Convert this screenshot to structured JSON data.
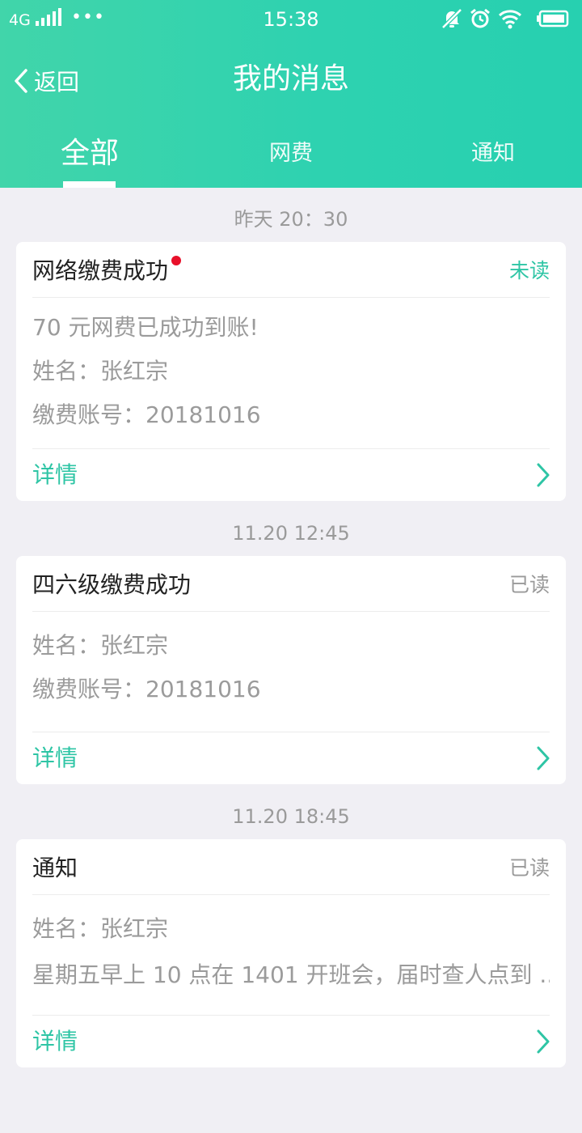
{
  "status_bar": {
    "network": "4G",
    "dots": "•••",
    "time": "15:38"
  },
  "nav": {
    "back_label": "返回",
    "title": "我的消息"
  },
  "tabs": [
    {
      "label": "全部",
      "active": true
    },
    {
      "label": "网费",
      "active": false
    },
    {
      "label": "通知",
      "active": false
    }
  ],
  "messages": [
    {
      "time": "昨天 20：30",
      "title": "网络缴费成功",
      "unread_dot": true,
      "status": "未读",
      "lines": [
        "70 元网费已成功到账!",
        "姓名：张红宗",
        "缴费账号：20181016"
      ],
      "detail_label": "详情"
    },
    {
      "time": "11.20 12:45",
      "title": "四六级缴费成功",
      "unread_dot": false,
      "status": "已读",
      "lines": [
        "姓名：张红宗",
        "缴费账号：20181016"
      ],
      "detail_label": "详情"
    },
    {
      "time": "11.20 18:45",
      "title": "通知",
      "unread_dot": false,
      "status": "已读",
      "lines": [
        "姓名：张红宗",
        "星期五早上 10 点在 1401 开班会，届时查人点到 ..."
      ],
      "detail_label": "详情"
    }
  ],
  "colors": {
    "header_gradient_start": "#41d5aa",
    "header_gradient_end": "#27d0b0",
    "accent": "#2ec5a5",
    "unread_dot": "#e8102a",
    "background": "#f0eff4"
  }
}
